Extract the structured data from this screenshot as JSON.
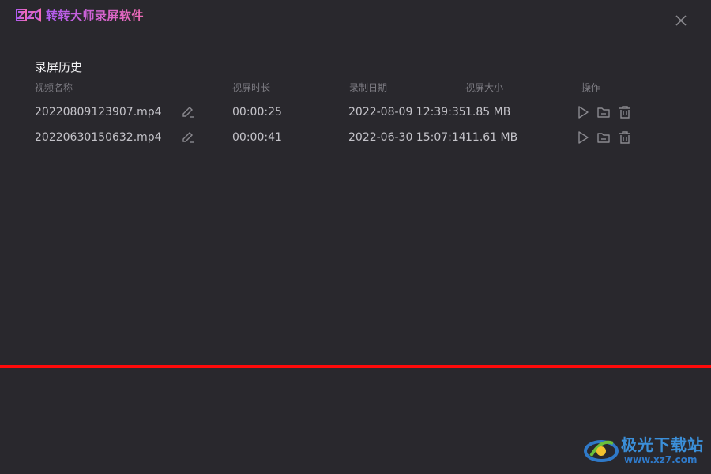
{
  "app": {
    "title": "转转大师录屏软件",
    "accent_gradient": [
      "#b05cf0",
      "#f06ab5"
    ]
  },
  "close_icon": "close-icon",
  "history": {
    "section_title": "录屏历史",
    "columns": {
      "name": "视频名称",
      "duration": "视屏时长",
      "date": "录制日期",
      "size": "视屏大小",
      "actions": "操作"
    },
    "rows": [
      {
        "name": "20220809123907.mp4",
        "duration": "00:00:25",
        "date": "2022-08-09 12:39:35",
        "size": "1.85 MB"
      },
      {
        "name": "20220630150632.mp4",
        "duration": "00:00:41",
        "date": "2022-06-30 15:07:14",
        "size": "11.61 MB"
      }
    ],
    "row_icons": [
      "edit-icon",
      "play-icon",
      "folder-icon",
      "trash-icon"
    ]
  },
  "divider_color": "#ff0a0a",
  "watermark": {
    "text": "极光下载站",
    "url": "www.xz7.com"
  }
}
